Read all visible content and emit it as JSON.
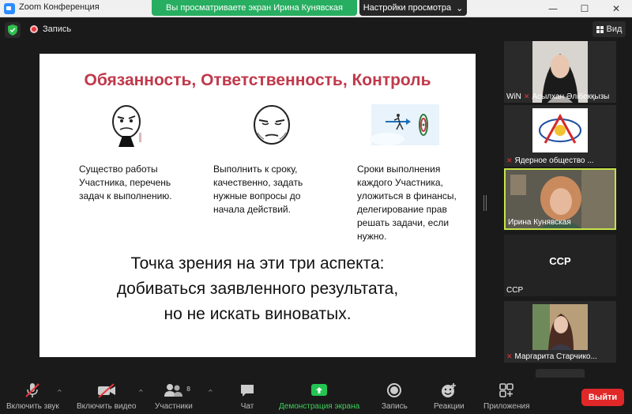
{
  "window": {
    "title": "Zoom Конференция",
    "controls": {
      "minimize": "—",
      "maximize": "☐",
      "close": "✕"
    }
  },
  "share_banner": {
    "text": "Вы просматриваете экран Ирина Кунявская",
    "view_options": "Настройки просмотра",
    "view_options_chevron": "⌄"
  },
  "top": {
    "record_label": "Запись",
    "view_label": "Вид"
  },
  "slide": {
    "title": "Обязанность, Ответственность, Контроль",
    "columns": [
      {
        "text_lines": [
          "Существо работы",
          "Участника, перечень",
          "задач к выполнению."
        ]
      },
      {
        "text_lines": [
          "Выполнить к сроку,",
          "качественно, задать",
          "нужные вопросы до",
          "начала действий."
        ]
      },
      {
        "text_lines": [
          "Сроки выполнения",
          "каждого Участника,",
          "уложиться в финансы,",
          "делегирование прав",
          "решать задачи, если",
          "нужно."
        ]
      }
    ],
    "bottom_lines": [
      "Точка зрения на эти три аспекта:",
      "добиваться заявленного результата,",
      "но не искать виноватых."
    ]
  },
  "gallery": {
    "tiles": [
      {
        "name": "Асылхан Әлібекқызы",
        "prefix": "WiN",
        "muted": true
      },
      {
        "name": "Ядерное общество ...",
        "muted": true
      },
      {
        "name": "Ирина Кунявская",
        "muted": false,
        "active": true
      },
      {
        "name": "CCP",
        "center_text": "CCP",
        "muted": false
      },
      {
        "name": "Маргарита Старчико...",
        "muted": true
      }
    ],
    "chevron": "⌄"
  },
  "toolbar": {
    "audio": "Включить звук",
    "video": "Включить видео",
    "participants": "Участники",
    "participants_count": "8",
    "chat": "Чат",
    "share": "Демонстрация экрана",
    "record": "Запись",
    "reactions": "Реакции",
    "apps": "Приложения",
    "leave": "Выйти",
    "caret": "^"
  },
  "colors": {
    "accent_green": "#27ae60",
    "title_red": "#c0394b",
    "leave_red": "#e02828",
    "active_border": "#c6e34a"
  }
}
